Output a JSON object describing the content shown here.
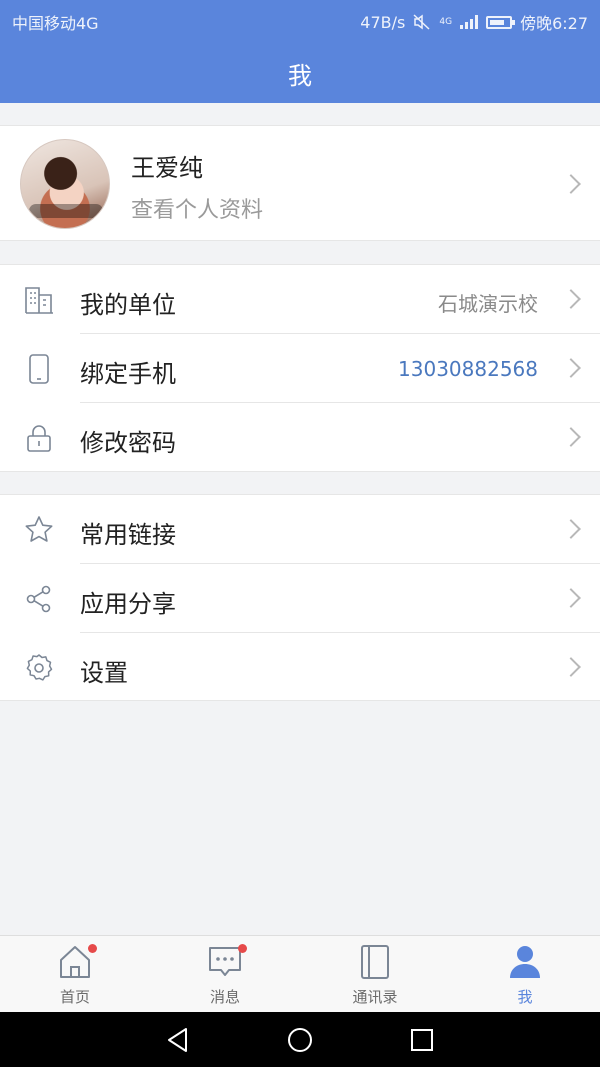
{
  "status": {
    "carrier": "中国移动4G",
    "speed": "47B/s",
    "network": "4G",
    "time": "傍晚6:27"
  },
  "header": {
    "title": "我"
  },
  "profile": {
    "name": "王爱纯",
    "subtitle": "查看个人资料",
    "avatar_icon": "avatar-photo"
  },
  "groups": [
    {
      "items": [
        {
          "label": "我的单位",
          "value": "石城演示校",
          "icon": "building-icon"
        },
        {
          "label": "绑定手机",
          "value": "13030882568",
          "icon": "phone-icon"
        },
        {
          "label": "修改密码",
          "value": "",
          "icon": "lock-icon"
        }
      ]
    },
    {
      "items": [
        {
          "label": "常用链接",
          "icon": "star-icon"
        },
        {
          "label": "应用分享",
          "icon": "share-icon"
        },
        {
          "label": "设置",
          "icon": "gear-icon"
        }
      ]
    }
  ],
  "tabbar": {
    "items": [
      {
        "label": "首页",
        "icon": "home-icon",
        "badge": true
      },
      {
        "label": "消息",
        "icon": "message-icon",
        "badge": true
      },
      {
        "label": "通讯录",
        "icon": "contacts-icon",
        "badge": false
      },
      {
        "label": "我",
        "icon": "person-icon",
        "badge": false
      }
    ],
    "active": "我"
  },
  "colors": {
    "header": "#5a85dc",
    "accent": "#5a85dc",
    "phone_value": "#4a78be",
    "badge": "#e64a4a"
  }
}
